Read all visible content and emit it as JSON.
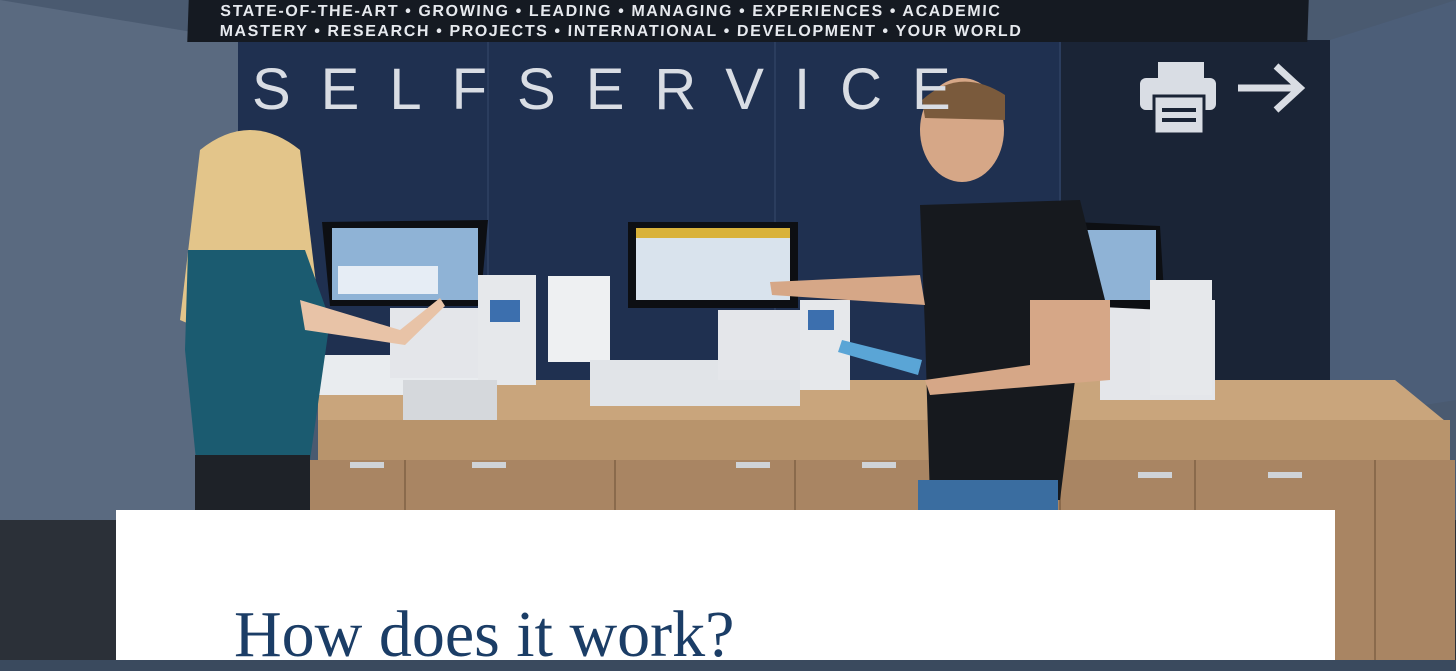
{
  "banner": {
    "line1": "STATE-OF-THE-ART • GROWING • LEADING • MANAGING • EXPERIENCES • ACADEMIC",
    "line2": "MASTERY • RESEARCH • PROJECTS • INTERNATIONAL • DEVELOPMENT • YOUR WORLD"
  },
  "wall_sign": {
    "title": "SELFSERVICE",
    "icons": [
      "printer-icon",
      "arrow-right-icon"
    ]
  },
  "section": {
    "heading": "How does it work?"
  },
  "colors": {
    "heading": "#1b3d66",
    "wall": "#1f3050",
    "counter": "#b8946c",
    "card": "#ffffff"
  }
}
